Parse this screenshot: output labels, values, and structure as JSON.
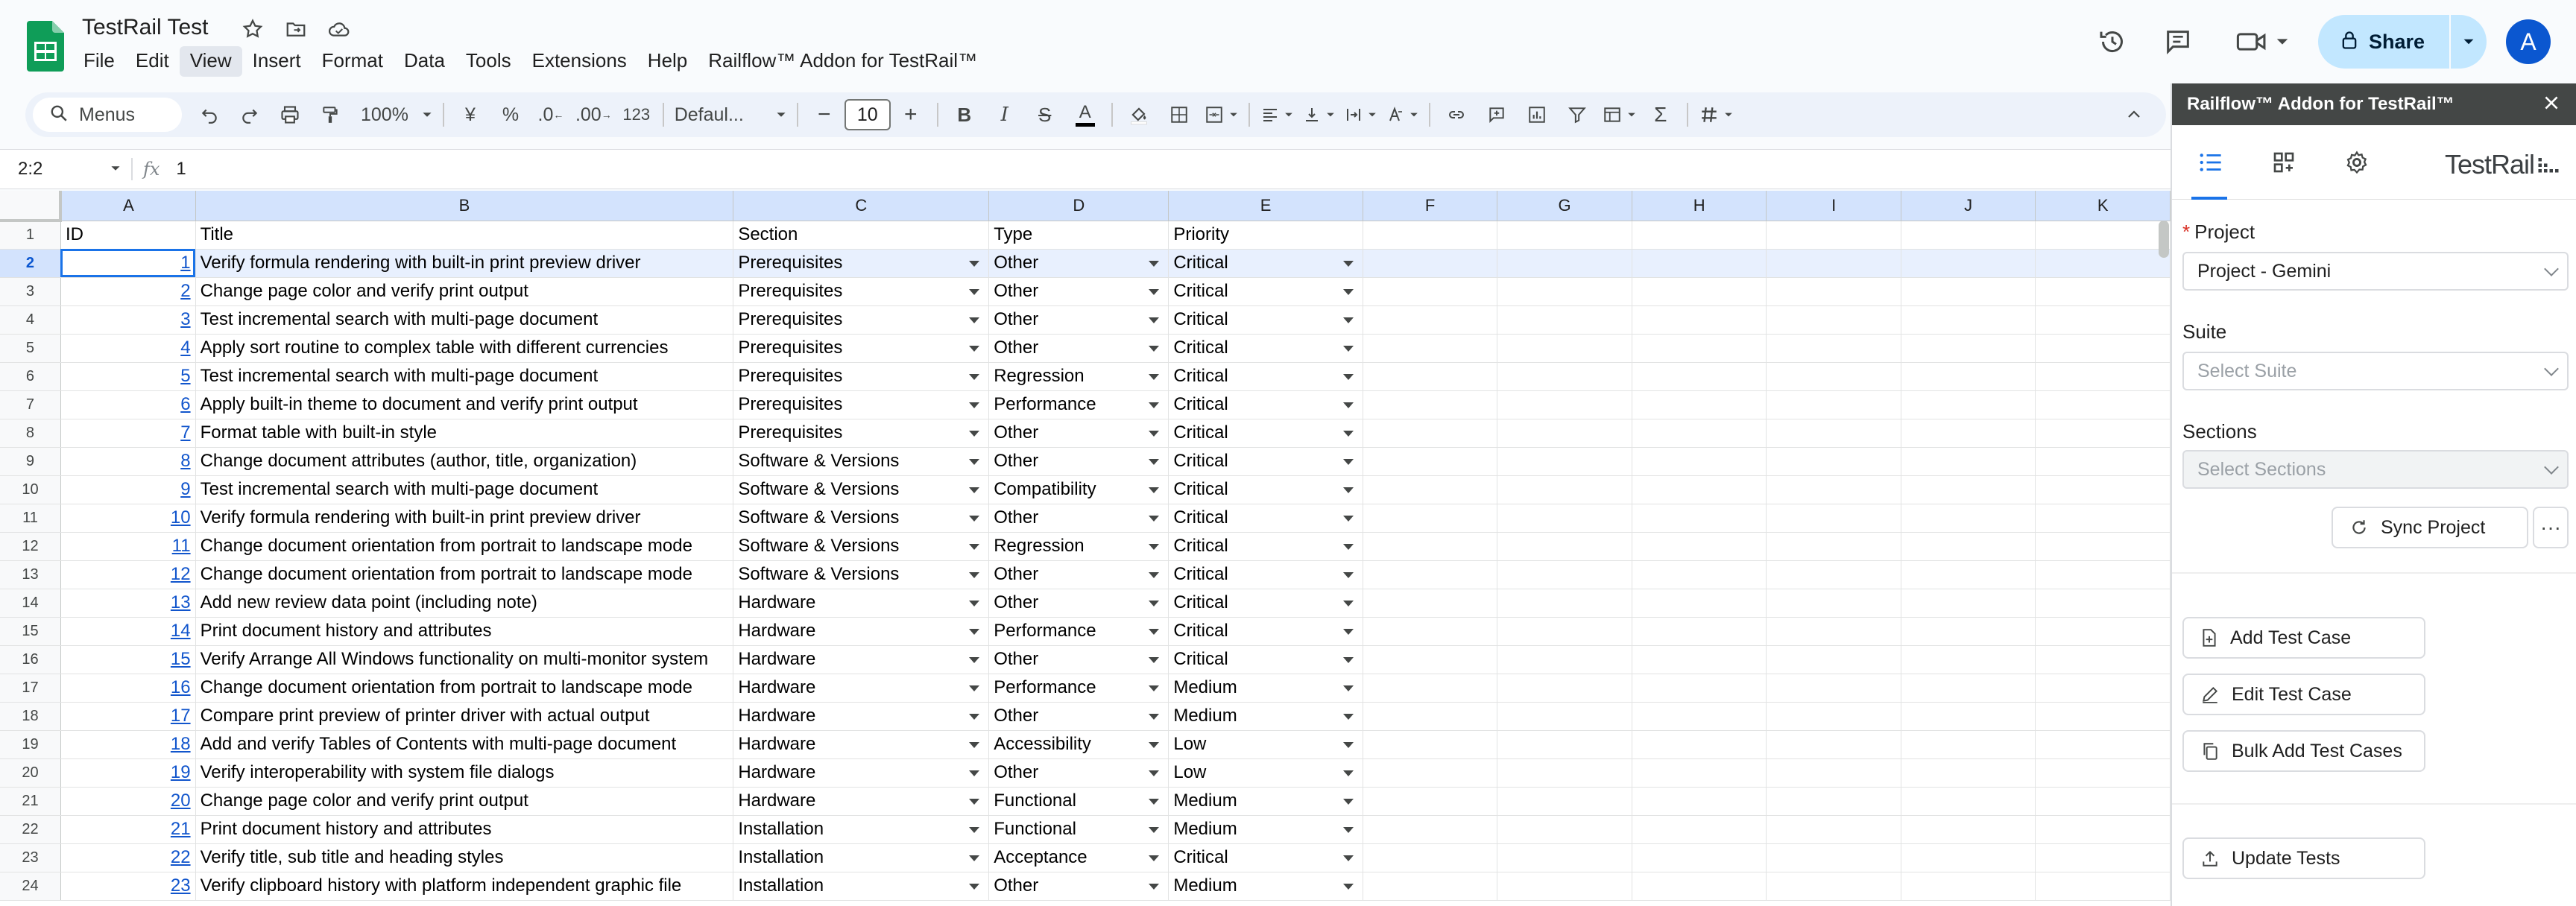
{
  "doc": {
    "title": "TestRail Test"
  },
  "menus": [
    "File",
    "Edit",
    "View",
    "Insert",
    "Format",
    "Data",
    "Tools",
    "Extensions",
    "Help",
    "Railflow™ Addon for TestRail™"
  ],
  "header": {
    "share_label": "Share",
    "avatar_letter": "A"
  },
  "toolbar": {
    "search_label": "Menus",
    "zoom": "100%",
    "currency": "¥",
    "percent": "%",
    "dec_decrease": ".0",
    "dec_increase": ".00",
    "number_format": "123",
    "font": "Defaul...",
    "font_size": "10",
    "bold": "B",
    "italic": "I",
    "strike": "S",
    "text_color": "A",
    "sum": "Σ"
  },
  "formula_bar": {
    "cell_ref": "2:2",
    "fx": "fx",
    "value": "1"
  },
  "columns": [
    "A",
    "B",
    "C",
    "D",
    "E",
    "F",
    "G",
    "H",
    "I",
    "J",
    "K"
  ],
  "header_row": {
    "id": "ID",
    "title": "Title",
    "section": "Section",
    "type": "Type",
    "priority": "Priority"
  },
  "rows": [
    {
      "id": "1",
      "title": "Verify formula rendering with built-in print preview driver",
      "section": "Prerequisites",
      "type": "Other",
      "priority": "Critical"
    },
    {
      "id": "2",
      "title": "Change page color and verify print output",
      "section": "Prerequisites",
      "type": "Other",
      "priority": "Critical"
    },
    {
      "id": "3",
      "title": "Test incremental search with multi-page document",
      "section": "Prerequisites",
      "type": "Other",
      "priority": "Critical"
    },
    {
      "id": "4",
      "title": "Apply sort routine to complex table with different currencies",
      "section": "Prerequisites",
      "type": "Other",
      "priority": "Critical"
    },
    {
      "id": "5",
      "title": "Test incremental search with multi-page document",
      "section": "Prerequisites",
      "type": "Regression",
      "priority": "Critical"
    },
    {
      "id": "6",
      "title": "Apply built-in theme to document and verify print output",
      "section": "Prerequisites",
      "type": "Performance",
      "priority": "Critical"
    },
    {
      "id": "7",
      "title": "Format table with built-in style",
      "section": "Prerequisites",
      "type": "Other",
      "priority": "Critical"
    },
    {
      "id": "8",
      "title": "Change document attributes (author, title, organization)",
      "section": "Software & Versions",
      "type": "Other",
      "priority": "Critical"
    },
    {
      "id": "9",
      "title": "Test incremental search with multi-page document",
      "section": "Software & Versions",
      "type": "Compatibility",
      "priority": "Critical"
    },
    {
      "id": "10",
      "title": "Verify formula rendering with built-in print preview driver",
      "section": "Software & Versions",
      "type": "Other",
      "priority": "Critical"
    },
    {
      "id": "11",
      "title": "Change document orientation from portrait to landscape mode",
      "section": "Software & Versions",
      "type": "Regression",
      "priority": "Critical"
    },
    {
      "id": "12",
      "title": "Change document orientation from portrait to landscape mode",
      "section": "Software & Versions",
      "type": "Other",
      "priority": "Critical"
    },
    {
      "id": "13",
      "title": "Add new review data point (including note)",
      "section": "Hardware",
      "type": "Other",
      "priority": "Critical"
    },
    {
      "id": "14",
      "title": "Print document history and attributes",
      "section": "Hardware",
      "type": "Performance",
      "priority": "Critical"
    },
    {
      "id": "15",
      "title": "Verify Arrange All Windows functionality on multi-monitor system",
      "section": "Hardware",
      "type": "Other",
      "priority": "Critical"
    },
    {
      "id": "16",
      "title": "Change document orientation from portrait to landscape mode",
      "section": "Hardware",
      "type": "Performance",
      "priority": "Medium"
    },
    {
      "id": "17",
      "title": "Compare print preview of printer driver with actual output",
      "section": "Hardware",
      "type": "Other",
      "priority": "Medium"
    },
    {
      "id": "18",
      "title": "Add and verify Tables of Contents with multi-page document",
      "section": "Hardware",
      "type": "Accessibility",
      "priority": "Low"
    },
    {
      "id": "19",
      "title": "Verify interoperability with system file dialogs",
      "section": "Hardware",
      "type": "Other",
      "priority": "Low"
    },
    {
      "id": "20",
      "title": "Change page color and verify print output",
      "section": "Hardware",
      "type": "Functional",
      "priority": "Medium"
    },
    {
      "id": "21",
      "title": "Print document history and attributes",
      "section": "Installation",
      "type": "Functional",
      "priority": "Medium"
    },
    {
      "id": "22",
      "title": "Verify title, sub title and heading styles",
      "section": "Installation",
      "type": "Acceptance",
      "priority": "Critical"
    },
    {
      "id": "23",
      "title": "Verify clipboard history with platform independent graphic file",
      "section": "Installation",
      "type": "Other",
      "priority": "Medium"
    }
  ],
  "sidebar": {
    "title": "Railflow™ Addon for TestRail™",
    "logo_text": "TestRail",
    "project_label": "Project",
    "project_required": "*",
    "project_value": "Project - Gemini",
    "suite_label": "Suite",
    "suite_placeholder": "Select Suite",
    "sections_label": "Sections",
    "sections_placeholder": "Select Sections",
    "sync_label": "Sync Project",
    "more_label": "···",
    "add_label": "Add Test Case",
    "edit_label": "Edit Test Case",
    "bulk_label": "Bulk Add Test Cases",
    "update_label": "Update Tests"
  },
  "colors": {
    "accent": "#1a73e8",
    "share_bg": "#c2e7ff",
    "sheets_green": "#0f9d58",
    "selection": "#d3e3fd"
  }
}
